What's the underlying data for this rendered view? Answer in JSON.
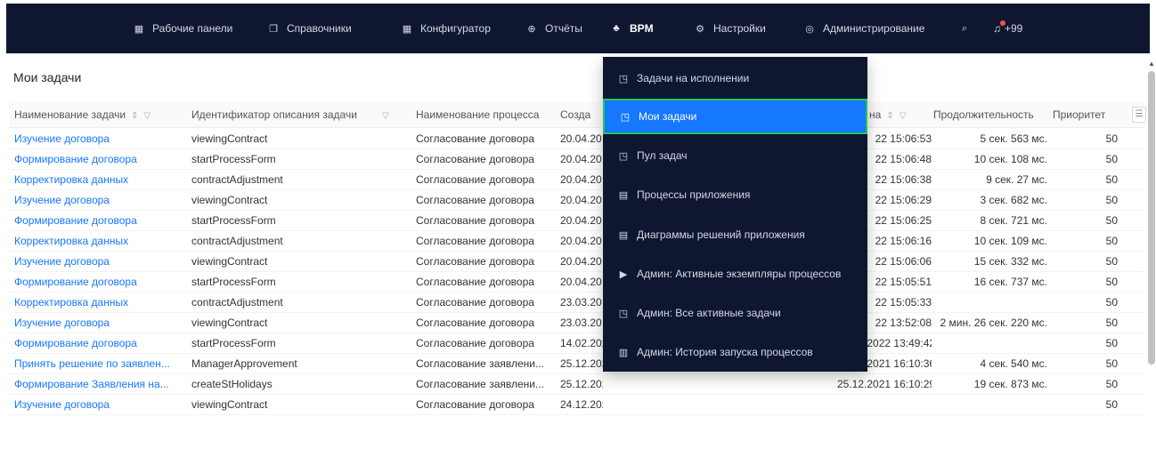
{
  "nav": {
    "items": [
      {
        "label": "Рабочие панели",
        "icon": "dashboard-icon"
      },
      {
        "label": "Справочники",
        "icon": "book-icon"
      },
      {
        "label": "Конфигуратор",
        "icon": "grid-icon"
      },
      {
        "label": "Отчёты",
        "icon": "report-icon"
      },
      {
        "label": "BPM",
        "icon": "flow-icon"
      },
      {
        "label": "Настройки",
        "icon": "gear-icon"
      },
      {
        "label": "Администрирование",
        "icon": "shield-icon"
      }
    ],
    "notifications": "+99"
  },
  "page_title": "Мои задачи",
  "table": {
    "columns": [
      {
        "label": "Наименование задачи"
      },
      {
        "label": "Идентификатор описания задачи"
      },
      {
        "label": "Наименование процесса"
      },
      {
        "label": "Созда"
      },
      {
        "label": "на"
      },
      {
        "label": "Продолжительность"
      },
      {
        "label": "Приоритет"
      }
    ],
    "rows": [
      {
        "name": "Изучение договора",
        "id": "viewingContract",
        "process": "Согласование договора",
        "created": "20.04.20",
        "finished": "22 15:06:53",
        "duration": "5 сек. 563 мс.",
        "priority": "50"
      },
      {
        "name": "Формирование договора",
        "id": "startProcessForm",
        "process": "Согласование договора",
        "created": "20.04.20",
        "finished": "22 15:06:48",
        "duration": "10 сек. 108 мс.",
        "priority": "50"
      },
      {
        "name": "Корректировка данных",
        "id": "contractAdjustment",
        "process": "Согласование договора",
        "created": "20.04.20",
        "finished": "22 15:06:38",
        "duration": "9 сек. 27 мс.",
        "priority": "50"
      },
      {
        "name": "Изучение договора",
        "id": "viewingContract",
        "process": "Согласование договора",
        "created": "20.04.20",
        "finished": "22 15:06:29",
        "duration": "3 сек. 682 мс.",
        "priority": "50"
      },
      {
        "name": "Формирование договора",
        "id": "startProcessForm",
        "process": "Согласование договора",
        "created": "20.04.20",
        "finished": "22 15:06:25",
        "duration": "8 сек. 721 мс.",
        "priority": "50"
      },
      {
        "name": "Корректировка данных",
        "id": "contractAdjustment",
        "process": "Согласование договора",
        "created": "20.04.20",
        "finished": "22 15:06:16",
        "duration": "10 сек. 109 мс.",
        "priority": "50"
      },
      {
        "name": "Изучение договора",
        "id": "viewingContract",
        "process": "Согласование договора",
        "created": "20.04.20",
        "finished": "22 15:06:06",
        "duration": "15 сек. 332 мс.",
        "priority": "50"
      },
      {
        "name": "Формирование договора",
        "id": "startProcessForm",
        "process": "Согласование договора",
        "created": "20.04.20",
        "finished": "22 15:05:51",
        "duration": "16 сек. 737 мс.",
        "priority": "50"
      },
      {
        "name": "Корректировка данных",
        "id": "contractAdjustment",
        "process": "Согласование договора",
        "created": "23.03.20",
        "finished": "22 15:05:33",
        "duration": "",
        "priority": "50"
      },
      {
        "name": "Изучение договора",
        "id": "viewingContract",
        "process": "Согласование договора",
        "created": "23.03.20",
        "finished": "22 13:52:08",
        "duration": "2 мин. 26 сек. 220 мс.",
        "priority": "50"
      },
      {
        "name": "Формирование договора",
        "id": "startProcessForm",
        "process": "Согласование договора",
        "created": "14.02.2022 11:05:19",
        "finished": "23.03.2022 13:49:42",
        "duration": "",
        "priority": "50"
      },
      {
        "name": "Принять решение по заявлен...",
        "id": "ManagerApprovement",
        "process": "Согласование заявлени...",
        "created": "25.12.2021 16:10:32",
        "finished": "25.12.2021 16:10:36",
        "duration": "4 сек. 540 мс.",
        "priority": "50"
      },
      {
        "name": "Формирование Заявления на...",
        "id": "createStHolidays",
        "process": "Согласование заявлени...",
        "created": "25.12.2021 16:10:09",
        "finished": "25.12.2021 16:10:29",
        "duration": "19 сек. 873 мс.",
        "priority": "50"
      },
      {
        "name": "Изучение договора",
        "id": "viewingContract",
        "process": "Согласование договора",
        "created": "24.12.2021 17:59:04",
        "finished": "",
        "duration": "",
        "priority": "50"
      }
    ]
  },
  "bpm_menu": {
    "items": [
      {
        "label": "Задачи на исполнении",
        "icon": "task-icon"
      },
      {
        "label": "Мои задачи",
        "icon": "task-icon",
        "selected": true
      },
      {
        "label": "Пул задач",
        "icon": "task-icon"
      },
      {
        "label": "Процессы приложения",
        "icon": "document-icon"
      },
      {
        "label": "Диаграммы решений приложения",
        "icon": "document-icon"
      },
      {
        "label": "Админ: Активные экземпляры процессов",
        "icon": "play-icon"
      },
      {
        "label": "Админ: Все активные задачи",
        "icon": "task-icon"
      },
      {
        "label": "Админ: История запуска процессов",
        "icon": "history-icon"
      }
    ]
  },
  "colors": {
    "navbar": "#0f1730",
    "accent": "#1677ff",
    "highlight_border": "#22c55e"
  }
}
